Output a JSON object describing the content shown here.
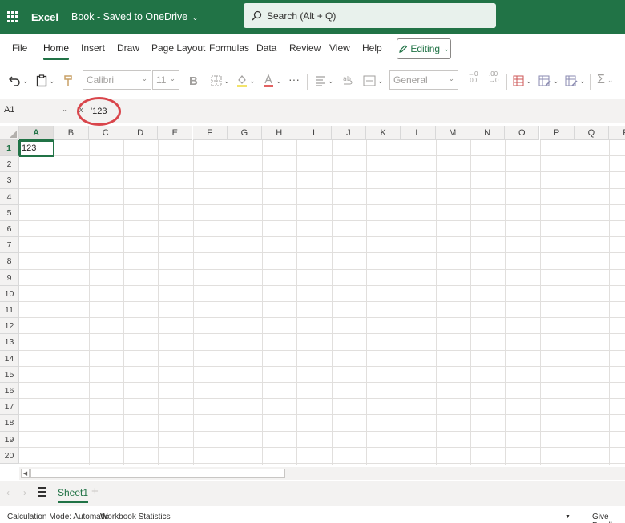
{
  "titlebar": {
    "app_name": "Excel",
    "doc_title": "Book - Saved to OneDrive",
    "search_placeholder": "Search (Alt + Q)"
  },
  "menu": {
    "tabs": [
      "File",
      "Home",
      "Insert",
      "Draw",
      "Page Layout",
      "Formulas",
      "Data",
      "Review",
      "View",
      "Help"
    ],
    "active_tab": "Home",
    "editing_label": "Editing"
  },
  "toolbar": {
    "font_name": "Calibri",
    "font_size": "11",
    "number_format": "General",
    "bold_label": "B",
    "more_label": "···"
  },
  "formula_bar": {
    "name_box": "A1",
    "fx_label": "fx",
    "value": "'123"
  },
  "grid": {
    "columns": [
      "A",
      "B",
      "C",
      "D",
      "E",
      "F",
      "G",
      "H",
      "I",
      "J",
      "K",
      "L",
      "M",
      "N",
      "O",
      "P",
      "Q",
      "R"
    ],
    "rows": [
      "1",
      "2",
      "3",
      "4",
      "5",
      "6",
      "7",
      "8",
      "9",
      "10",
      "11",
      "12",
      "13",
      "14",
      "15",
      "16",
      "17",
      "18",
      "19",
      "20"
    ],
    "active_column": "A",
    "active_row": "1",
    "cell_A1": "123"
  },
  "sheets": {
    "tabs": [
      "Sheet1"
    ],
    "add_label": "+"
  },
  "statusbar": {
    "calc_mode": "Calculation Mode: Automatic",
    "workbook_stats": "Workbook Statistics",
    "feedback": "Give Feedb"
  },
  "colors": {
    "accent": "#217346",
    "highlight_circle": "#d9454b"
  }
}
